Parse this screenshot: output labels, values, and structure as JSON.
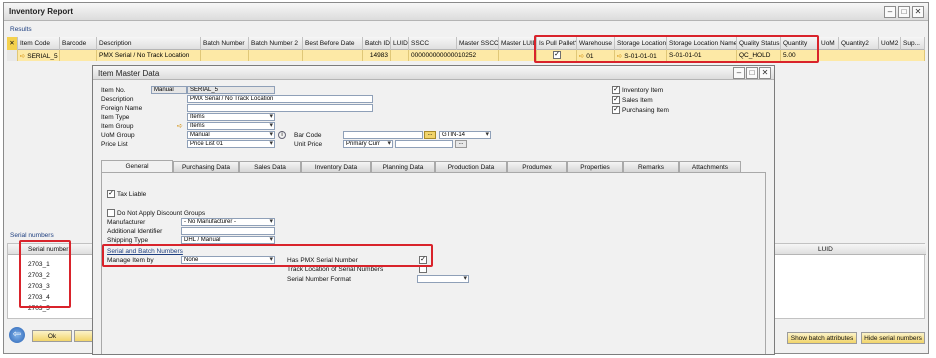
{
  "window": {
    "title": "Inventory Report",
    "section_results": "Results",
    "columns": [
      "Item Code",
      "Barcode",
      "Description",
      "Batch Number",
      "Batch Number 2",
      "Best Before Date",
      "Batch ID",
      "LUID",
      "SSCC",
      "Master SSCC",
      "Master LUID",
      "Is Pull Pallet?",
      "Warehouse",
      "Storage Location",
      "Storage Location Name",
      "Quality Status",
      "Quantity",
      "UoM",
      "Quantity2",
      "UoM2",
      "Sup..."
    ],
    "row": {
      "item_code": "SERIAL_5",
      "description": "PMX Serial / No Track Location",
      "batch_id": "14983",
      "sscc": "000000000000010252",
      "pull_pallet_checked": true,
      "warehouse": "01",
      "storage_location": "S-01-01-01",
      "storage_location_name": "S-01-01-01",
      "quality_status": "QC_HOLD",
      "quantity": "5.00"
    },
    "serial_section": "Serial numbers",
    "serial_header": "Serial number",
    "serials": [
      "2703_1",
      "2703_2",
      "2703_3",
      "2703_4",
      "2703_5"
    ],
    "luid_header": "LUID",
    "btn_ok": "Ok",
    "btn_show_batch": "Show batch attributes",
    "btn_hide_serial": "Hide serial numbers"
  },
  "dialog": {
    "title": "Item Master Data",
    "item_no_label": "Item No.",
    "item_no_mode": "Manual",
    "item_no": "SERIAL_5",
    "description_label": "Description",
    "description": "PMX Serial / No Track Location",
    "foreign_name_label": "Foreign Name",
    "item_type_label": "Item Type",
    "item_type": "Items",
    "item_group_label": "Item Group",
    "item_group": "Items",
    "uom_group_label": "UoM Group",
    "uom_group": "Manual",
    "price_list_label": "Price List",
    "price_list": "Price List 01",
    "bar_code_label": "Bar Code",
    "gtin": "GTIN-14",
    "unit_price_label": "Unit Price",
    "unit_price_currency": "Primary Curr",
    "inventory_item": "Inventory Item",
    "sales_item": "Sales Item",
    "purchasing_item": "Purchasing Item",
    "tabs": [
      "General",
      "Purchasing Data",
      "Sales Data",
      "Inventory Data",
      "Planning Data",
      "Production Data",
      "Produmex",
      "Properties",
      "Remarks",
      "Attachments"
    ],
    "tax_liable": "Tax Liable",
    "no_discount": "Do Not Apply Discount Groups",
    "manufacturer_label": "Manufacturer",
    "manufacturer": "- No Manufacturer -",
    "additional_id_label": "Additional Identifier",
    "shipping_type_label": "Shipping Type",
    "shipping_type": "DHL / Manual",
    "serial_batch_section": "Serial and Batch Numbers",
    "manage_item_by_label": "Manage Item by",
    "manage_item_by": "None",
    "has_pmx_serial": "Has PMX Serial Number",
    "track_location": "Track Location of Serial Numbers",
    "serial_format": "Serial Number Format"
  }
}
